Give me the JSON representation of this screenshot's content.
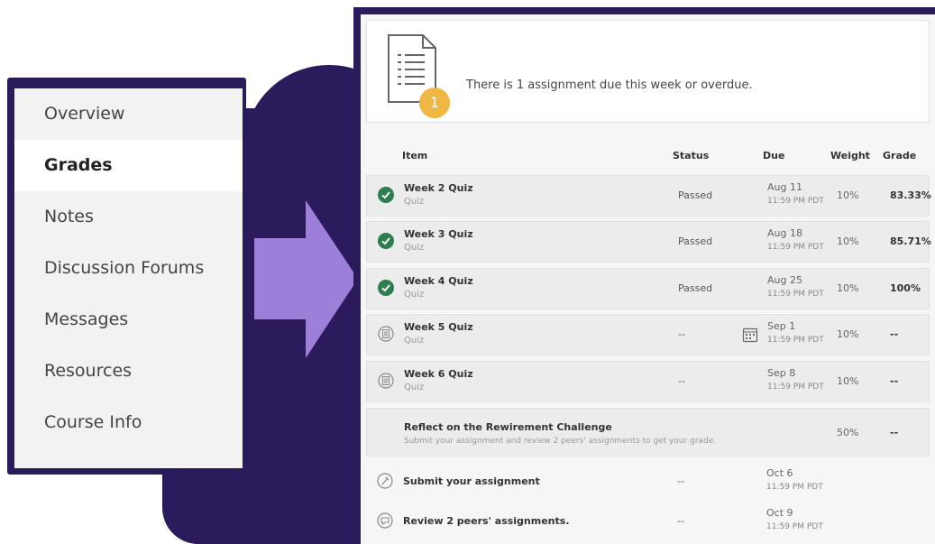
{
  "sidebar": {
    "items": [
      {
        "label": "Overview"
      },
      {
        "label": "Grades"
      },
      {
        "label": "Notes"
      },
      {
        "label": "Discussion Forums"
      },
      {
        "label": "Messages"
      },
      {
        "label": "Resources"
      },
      {
        "label": "Course Info"
      }
    ]
  },
  "banner": {
    "text": "There is 1 assignment due this week or overdue.",
    "badge": "1"
  },
  "table": {
    "headers": {
      "item": "Item",
      "status": "Status",
      "due": "Due",
      "weight": "Weight",
      "grade": "Grade"
    },
    "rows": [
      {
        "title": "Week 2 Quiz",
        "sub": "Quiz",
        "status": "Passed",
        "due1": "Aug 11",
        "due2": "11:59 PM PDT",
        "weight": "10%",
        "grade": "83.33%"
      },
      {
        "title": "Week 3 Quiz",
        "sub": "Quiz",
        "status": "Passed",
        "due1": "Aug 18",
        "due2": "11:59 PM PDT",
        "weight": "10%",
        "grade": "85.71%"
      },
      {
        "title": "Week 4 Quiz",
        "sub": "Quiz",
        "status": "Passed",
        "due1": "Aug 25",
        "due2": "11:59 PM PDT",
        "weight": "10%",
        "grade": "100%"
      },
      {
        "title": "Week 5 Quiz",
        "sub": "Quiz",
        "status": "--",
        "due1": "Sep 1",
        "due2": "11:59 PM PDT",
        "weight": "10%",
        "grade": "--"
      },
      {
        "title": "Week 6 Quiz",
        "sub": "Quiz",
        "status": "--",
        "due1": "Sep 8",
        "due2": "11:59 PM PDT",
        "weight": "10%",
        "grade": "--"
      },
      {
        "title": "Reflect on the Rewirement Challenge",
        "sub": "Submit your assignment and review 2 peers' assignments to get your grade.",
        "weight": "50%",
        "grade": "--"
      },
      {
        "title": "Submit your assignment",
        "status": "--",
        "due1": "Oct 6",
        "due2": "11:59 PM PDT"
      },
      {
        "title": "Review 2 peers' assignments.",
        "status": "--",
        "due1": "Oct 9",
        "due2": "11:59 PM PDT"
      }
    ]
  },
  "colors": {
    "brand_purple": "#2b1a5c",
    "arrow": "#9b7fd8",
    "check_green": "#2e7d4f",
    "badge": "#f0b742"
  }
}
